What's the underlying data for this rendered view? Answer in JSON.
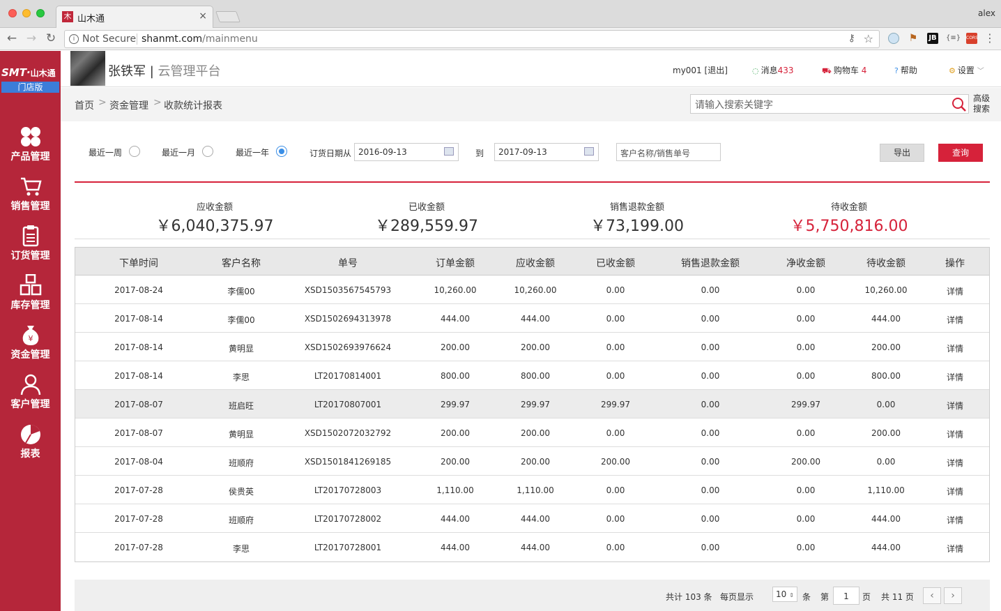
{
  "browser": {
    "tab_title": "山木通",
    "tab_favicon": "木",
    "tab_close": "×",
    "user": "alex",
    "security_label": "Not Secure",
    "url_host": "shanmt.com",
    "url_path": "/mainmenu",
    "ext_jb": "JB",
    "ext_json": "{≡}",
    "ext_cors": "CORS"
  },
  "sidebar": {
    "logo_text": "SMT·",
    "logo_cn": "山木通",
    "logo_sub": "门店版",
    "items": [
      {
        "label": "产品管理",
        "icon": "clover-icon"
      },
      {
        "label": "销售管理",
        "icon": "cart-icon"
      },
      {
        "label": "订货管理",
        "icon": "clipboard-icon"
      },
      {
        "label": "库存管理",
        "icon": "boxes-icon"
      },
      {
        "label": "资金管理",
        "icon": "money-bag-icon"
      },
      {
        "label": "客户管理",
        "icon": "user-icon"
      },
      {
        "label": "报表",
        "icon": "pie-chart-icon"
      }
    ]
  },
  "header": {
    "shop_name": "张铁军",
    "separator": "|",
    "platform": "云管理平台",
    "account": "my001",
    "logout": "[退出]",
    "messages_label": "消息",
    "messages_count": "433",
    "cart_label": "购物车",
    "cart_count": "4",
    "help": "帮助",
    "settings": "设置"
  },
  "breadcrumb": {
    "items": [
      "首页",
      "资金管理",
      "收款统计报表"
    ],
    "arrow": ">"
  },
  "search": {
    "placeholder": "请输入搜索关键字",
    "advanced": "高级搜索"
  },
  "filters": {
    "ranges": [
      {
        "label": "最近一周",
        "checked": false
      },
      {
        "label": "最近一月",
        "checked": false
      },
      {
        "label": "最近一年",
        "checked": true
      }
    ],
    "date_from_label": "订货日期从",
    "date_from": "2016-09-13",
    "date_to_label": "到",
    "date_to": "2017-09-13",
    "customer_placeholder": "客户名称/销售单号",
    "export_label": "导出",
    "query_label": "查询"
  },
  "summary": [
    {
      "label": "应收金额",
      "value": "￥6,040,375.97",
      "highlight": false
    },
    {
      "label": "已收金额",
      "value": "￥289,559.97",
      "highlight": false
    },
    {
      "label": "销售退款金额",
      "value": "￥73,199.00",
      "highlight": false
    },
    {
      "label": "待收金额",
      "value": "￥5,750,816.00",
      "highlight": true
    }
  ],
  "table": {
    "headers": [
      "下单时间",
      "客户名称",
      "单号",
      "订单金额",
      "应收金额",
      "已收金额",
      "销售退款金额",
      "净收金额",
      "待收金额",
      "操作"
    ],
    "rows": [
      [
        "2017-08-24",
        "李儒00",
        "XSD1503567545793",
        "10,260.00",
        "10,260.00",
        "0.00",
        "0.00",
        "0.00",
        "10,260.00",
        "详情"
      ],
      [
        "2017-08-14",
        "李儒00",
        "XSD1502694313978",
        "444.00",
        "444.00",
        "0.00",
        "0.00",
        "0.00",
        "444.00",
        "详情"
      ],
      [
        "2017-08-14",
        "黄明显",
        "XSD1502693976624",
        "200.00",
        "200.00",
        "0.00",
        "0.00",
        "0.00",
        "200.00",
        "详情"
      ],
      [
        "2017-08-14",
        "李思",
        "LT20170814001",
        "800.00",
        "800.00",
        "0.00",
        "0.00",
        "0.00",
        "800.00",
        "详情"
      ],
      [
        "2017-08-07",
        "班启旺",
        "LT20170807001",
        "299.97",
        "299.97",
        "299.97",
        "0.00",
        "299.97",
        "0.00",
        "详情"
      ],
      [
        "2017-08-07",
        "黄明显",
        "XSD1502072032792",
        "200.00",
        "200.00",
        "0.00",
        "0.00",
        "0.00",
        "200.00",
        "详情"
      ],
      [
        "2017-08-04",
        "班顺府",
        "XSD1501841269185",
        "200.00",
        "200.00",
        "200.00",
        "0.00",
        "200.00",
        "0.00",
        "详情"
      ],
      [
        "2017-07-28",
        "侯贵英",
        "LT20170728003",
        "1,110.00",
        "1,110.00",
        "0.00",
        "0.00",
        "0.00",
        "1,110.00",
        "详情"
      ],
      [
        "2017-07-28",
        "班顺府",
        "LT20170728002",
        "444.00",
        "444.00",
        "0.00",
        "0.00",
        "0.00",
        "444.00",
        "详情"
      ],
      [
        "2017-07-28",
        "李思",
        "LT20170728001",
        "444.00",
        "444.00",
        "0.00",
        "0.00",
        "0.00",
        "444.00",
        "详情"
      ]
    ],
    "highlighted_row": 4
  },
  "pager": {
    "total": "共计 103 条",
    "per_page_label": "每页显示",
    "per_page": "10",
    "per_page_unit": "条",
    "page_prefix": "第",
    "current_page": "1",
    "page_suffix": "页",
    "total_pages": "共 11 页",
    "prev": "‹",
    "next": "›"
  },
  "colors": {
    "brand_red": "#d6223a",
    "sidebar": "#b5263a",
    "radio_blue": "#3a8ee6"
  }
}
